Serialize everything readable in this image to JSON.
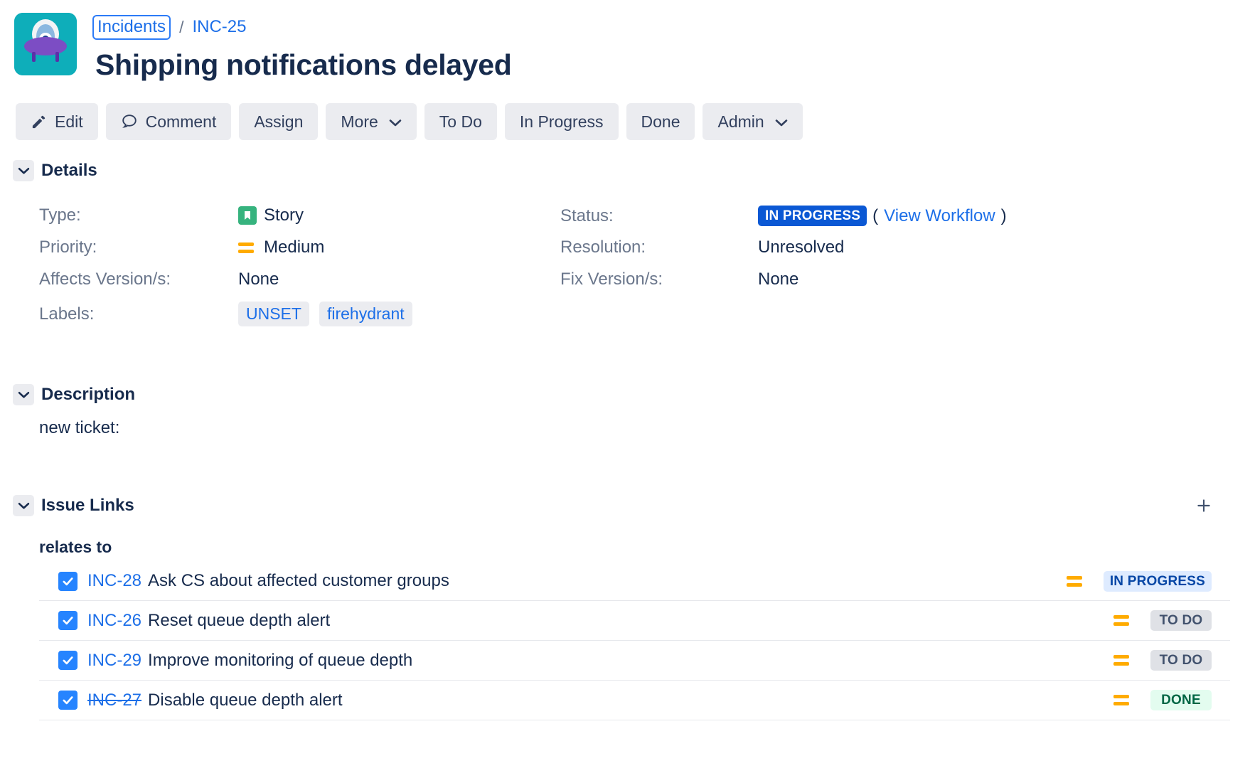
{
  "header": {
    "avatar_icon": "ufo-avatar-icon",
    "breadcrumb": {
      "project": "Incidents",
      "separator": "/",
      "issue_key": "INC-25"
    },
    "title": "Shipping notifications delayed"
  },
  "toolbar": {
    "edit_label": "Edit",
    "comment_label": "Comment",
    "assign_label": "Assign",
    "more_label": "More",
    "todo_label": "To Do",
    "inprogress_label": "In Progress",
    "done_label": "Done",
    "admin_label": "Admin"
  },
  "details": {
    "section_title": "Details",
    "type_label": "Type:",
    "type_value": "Story",
    "priority_label": "Priority:",
    "priority_value": "Medium",
    "affects_label": "Affects Version/s:",
    "affects_value": "None",
    "labels_label": "Labels:",
    "labels": [
      "UNSET",
      "firehydrant"
    ],
    "status_label": "Status:",
    "status_value": "IN PROGRESS",
    "view_workflow_open": "(",
    "view_workflow": "View Workflow",
    "view_workflow_close": ")",
    "resolution_label": "Resolution:",
    "resolution_value": "Unresolved",
    "fix_label": "Fix Version/s:",
    "fix_value": "None"
  },
  "description": {
    "section_title": "Description",
    "body": "new ticket:"
  },
  "issue_links": {
    "section_title": "Issue Links",
    "add_icon": "plus-icon",
    "group_name": "relates to",
    "rows": [
      {
        "key": "INC-28",
        "summary": "Ask CS about affected customer groups",
        "priority": "Medium",
        "status": "IN PROGRESS",
        "status_kind": "inprogress",
        "resolved": false,
        "checked": true
      },
      {
        "key": "INC-26",
        "summary": "Reset queue depth alert",
        "priority": "Medium",
        "status": "TO DO",
        "status_kind": "todo",
        "resolved": false,
        "checked": true
      },
      {
        "key": "INC-29",
        "summary": "Improve monitoring of queue depth",
        "priority": "Medium",
        "status": "TO DO",
        "status_kind": "todo",
        "resolved": false,
        "checked": true
      },
      {
        "key": "INC-27",
        "summary": "Disable queue depth alert",
        "priority": "Medium",
        "status": "DONE",
        "status_kind": "done",
        "resolved": true,
        "checked": true
      }
    ]
  },
  "colors": {
    "link_blue": "#1d6fe8",
    "status_blue": "#0B58D4",
    "story_green": "#36B37E",
    "priority_orange": "#FFAB00",
    "text_dark": "#172B4D",
    "label_gray": "#6B778C",
    "button_gray": "#EBECF0",
    "avatar_teal": "#0eaeba"
  }
}
